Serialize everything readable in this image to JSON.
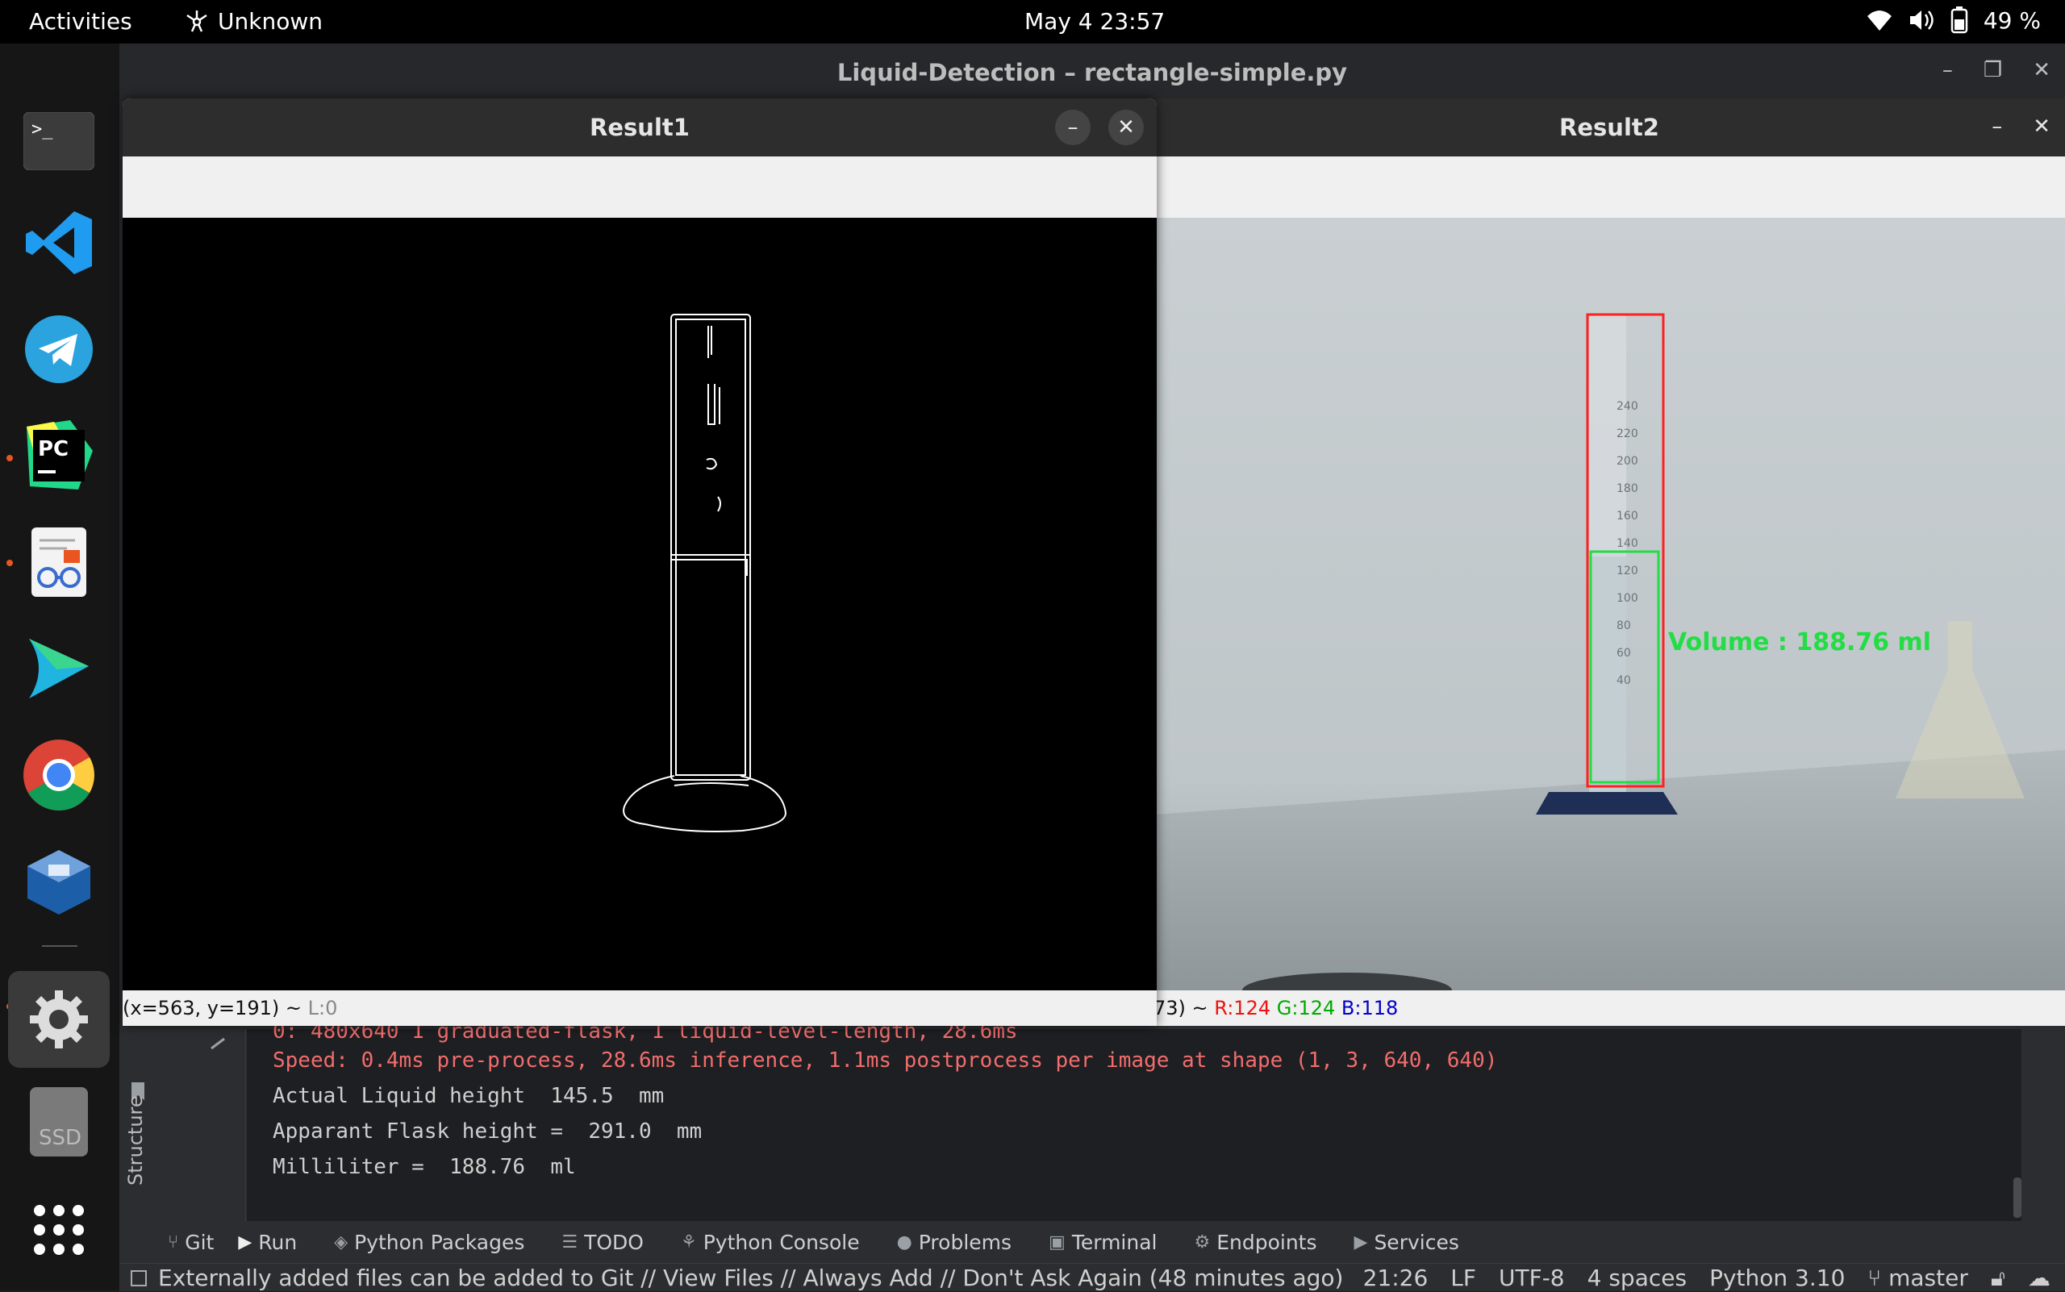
{
  "topbar": {
    "activities": "Activities",
    "app_name": "Unknown",
    "clock": "May 4  23:57",
    "battery": "49 %"
  },
  "dock": {
    "items": [
      "terminal",
      "vscode",
      "telegram",
      "pycharm",
      "document-viewer",
      "browser",
      "chrome",
      "virtualbox",
      "settings",
      "ssd",
      "app-grid"
    ],
    "ssd_label": "SSD"
  },
  "pycharm": {
    "title": "Liquid-Detection – rectangle-simple.py",
    "structure_label": "Structure",
    "console": {
      "lines": [
        {
          "text": "0: 480x640 1 graduated-flask, 1 liquid-level-length, 28.6ms",
          "kind": "err"
        },
        {
          "text": "Speed: 0.4ms pre-process, 28.6ms inference, 1.1ms postprocess per image at shape (1, 3, 640, 640)",
          "kind": "err"
        },
        {
          "text": "Actual Liquid height  145.5  mm",
          "kind": "out"
        },
        {
          "text": "Apparant Flask height =  291.0  mm",
          "kind": "out"
        },
        {
          "text": "Milliliter =  188.76  ml",
          "kind": "out"
        }
      ]
    },
    "tabs": [
      "Git",
      "Run",
      "Python Packages",
      "TODO",
      "Python Console",
      "Problems",
      "Terminal",
      "Endpoints",
      "Services"
    ],
    "statusbar": {
      "message": "Externally added files can be added to Git // View Files // Always Add // Don't Ask Again (48 minutes ago)",
      "position": "21:26",
      "line_sep": "LF",
      "encoding": "UTF-8",
      "indent": "4 spaces",
      "interpreter": "Python 3.10",
      "branch": "master"
    }
  },
  "result1": {
    "title": "Result1",
    "status": "(x=563, y=191) ~",
    "status_suffix": "L:0"
  },
  "result2": {
    "title": "Result2",
    "status_prefix": "73) ~",
    "r": "R:124",
    "g": "G:124",
    "b": "B:118",
    "overlay_text": "Volume : 188.76 ml",
    "scale_marks": [
      "240",
      "220",
      "200",
      "180",
      "160",
      "140",
      "120",
      "100",
      "80",
      "60",
      "40"
    ]
  },
  "colors": {
    "accent_orange": "#e95420",
    "detect_red": "#ff2020",
    "detect_green": "#22dd44"
  }
}
